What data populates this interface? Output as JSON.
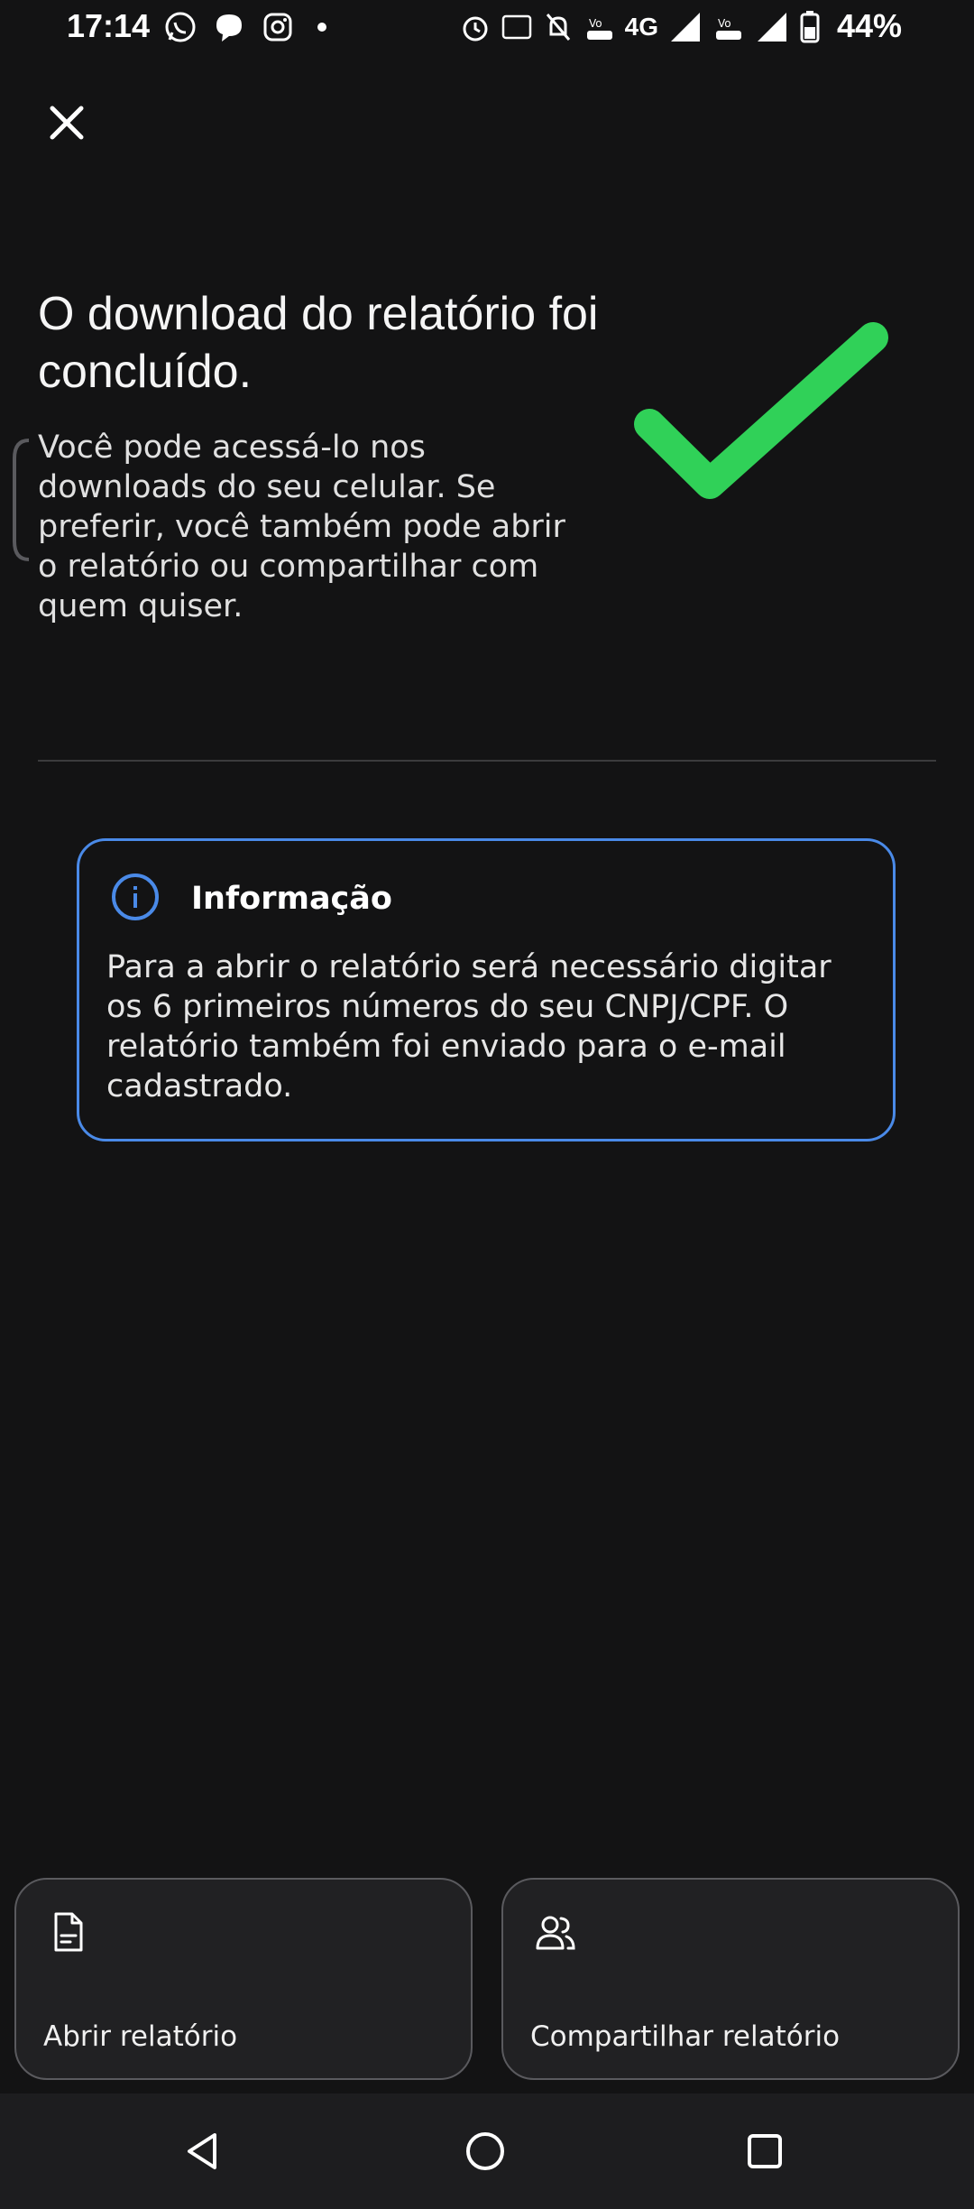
{
  "status_bar": {
    "time": "17:14",
    "battery": "44%",
    "network": "4G"
  },
  "header": {
    "close_icon": "close-icon"
  },
  "main": {
    "title": "O download do relatório foi concluído.",
    "description": "Você pode acessá-lo nos downloads do seu celular. Se preferir, você também pode abrir o relatório ou compartilhar com quem quiser.",
    "success_icon": "check-icon",
    "accent_color": "#30d158"
  },
  "info_card": {
    "title": "Informação",
    "text": "Para a abrir o relatório será necessário digitar os 6 primeiros números do seu CNPJ/CPF. O relatório também foi enviado para o e-mail cadastrado.",
    "border_color": "#4a8ae8"
  },
  "actions": {
    "open_label": "Abrir relatório",
    "share_label": "Compartilhar relatório"
  },
  "nav": {
    "back": "back-icon",
    "home": "home-icon",
    "recents": "recents-icon"
  }
}
